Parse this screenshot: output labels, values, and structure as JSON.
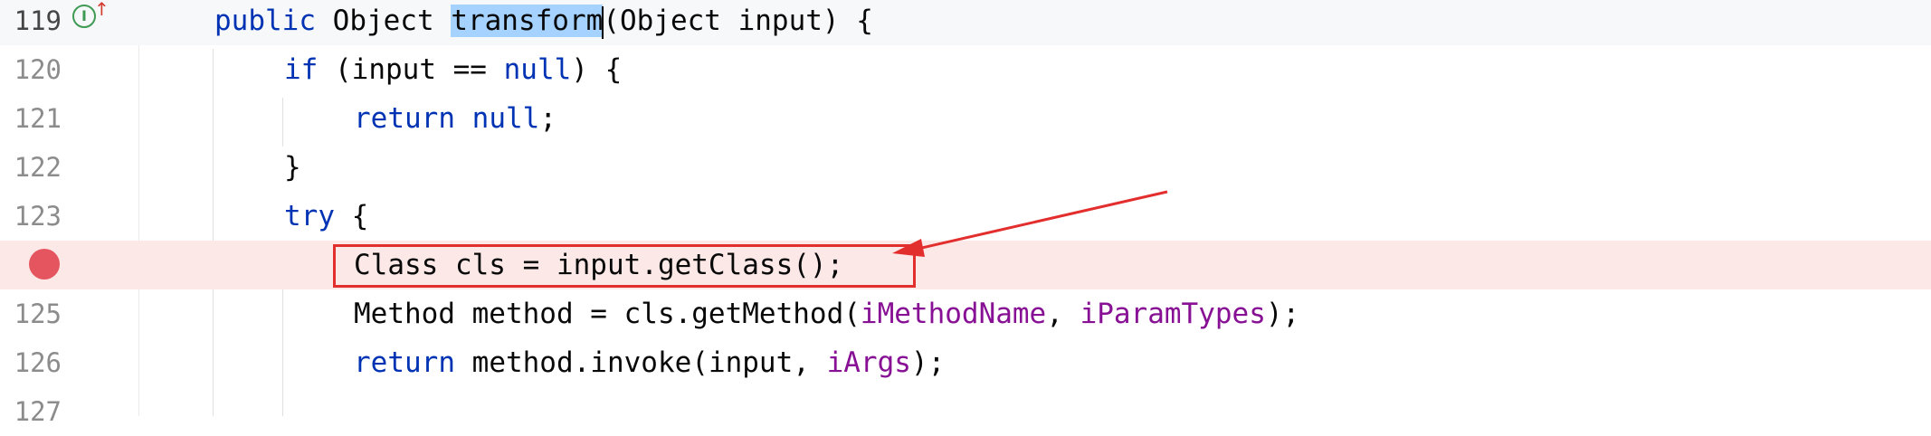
{
  "editor": {
    "lines": [
      {
        "number": "119",
        "tokens": [
          {
            "text": "public ",
            "type": "kw"
          },
          {
            "text": "Object ",
            "type": "plain"
          },
          {
            "text": "transform",
            "type": "sel"
          },
          {
            "text": "(Object input) {",
            "type": "plain"
          }
        ]
      },
      {
        "number": "120",
        "tokens": [
          {
            "text": "if ",
            "type": "kw"
          },
          {
            "text": "(input == ",
            "type": "plain"
          },
          {
            "text": "null",
            "type": "kw"
          },
          {
            "text": ") {",
            "type": "plain"
          }
        ]
      },
      {
        "number": "121",
        "tokens": [
          {
            "text": "return ",
            "type": "kw"
          },
          {
            "text": "null",
            "type": "kw"
          },
          {
            "text": ";",
            "type": "plain"
          }
        ]
      },
      {
        "number": "122",
        "tokens": [
          {
            "text": "}",
            "type": "plain"
          }
        ]
      },
      {
        "number": "123",
        "tokens": [
          {
            "text": "try ",
            "type": "kw"
          },
          {
            "text": "{",
            "type": "plain"
          }
        ]
      },
      {
        "number": "",
        "tokens": [
          {
            "text": "Class cls = input.getClass();",
            "type": "plain"
          }
        ]
      },
      {
        "number": "125",
        "tokens": [
          {
            "text": "Method method = cls.getMethod(",
            "type": "plain"
          },
          {
            "text": "iMethodName",
            "type": "field"
          },
          {
            "text": ", ",
            "type": "plain"
          },
          {
            "text": "iParamTypes",
            "type": "field"
          },
          {
            "text": ");",
            "type": "plain"
          }
        ]
      },
      {
        "number": "126",
        "tokens": [
          {
            "text": "return ",
            "type": "kw"
          },
          {
            "text": "method.invoke(input, ",
            "type": "plain"
          },
          {
            "text": "iArgs",
            "type": "field"
          },
          {
            "text": ");",
            "type": "plain"
          }
        ]
      },
      {
        "number": "127",
        "tokens": []
      }
    ],
    "gutter_icons": {
      "implements_icon": "I",
      "override_arrow": "↑"
    },
    "colors": {
      "keyword": "#0033b3",
      "field": "#871094",
      "selection": "#a6d2ff",
      "breakpoint": "#e5555f",
      "breakpoint_line": "#fbe8e7",
      "annotation": "#e32e2e"
    }
  }
}
